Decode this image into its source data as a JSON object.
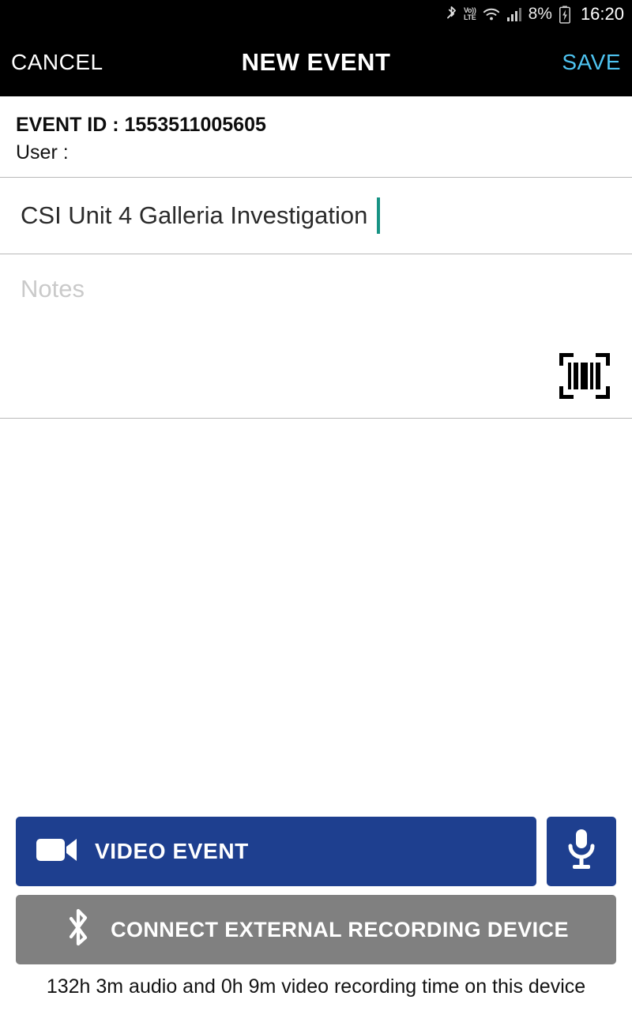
{
  "statusbar": {
    "bluetooth_icon": "bluetooth-icon",
    "volte_top": "Vo))",
    "volte_bottom": "LTE",
    "wifi_icon": "wifi-icon",
    "signal_icon": "cellular-signal-icon",
    "battery_percent": "8%",
    "battery_icon": "battery-charging-icon",
    "time": "16:20"
  },
  "appbar": {
    "cancel_label": "CANCEL",
    "title": "NEW EVENT",
    "save_label": "SAVE",
    "save_color": "#4ec3f0"
  },
  "info": {
    "event_id_label": "EVENT ID : 1553511005605",
    "user_label": "User :"
  },
  "title_field": {
    "value": "CSI Unit 4 Galleria Investigation",
    "caret_color": "#179384"
  },
  "notes_field": {
    "placeholder": "Notes",
    "value": "",
    "barcode_icon": "barcode-scan-icon"
  },
  "actions": {
    "video_event_label": "VIDEO EVENT",
    "video_icon": "video-camera-icon",
    "mic_icon": "microphone-icon",
    "bluetooth_connect_label": "CONNECT EXTERNAL RECORDING DEVICE",
    "bluetooth_icon": "bluetooth-icon",
    "primary_color": "#1e3f8f",
    "secondary_color": "#808080"
  },
  "footer": {
    "recording_time_note": "132h 3m audio and 0h 9m video recording time on this device"
  }
}
